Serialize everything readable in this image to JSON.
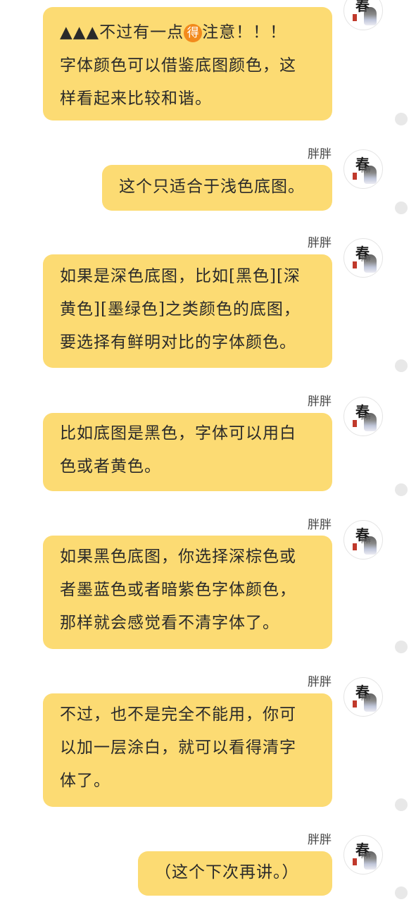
{
  "chat": {
    "messages": [
      {
        "sender": "",
        "lines": [
          "▲▲▲不过有一点{得}注意！！！",
          "字体颜色可以借鉴底图颜色，这",
          "样看起来比较和谐。"
        ],
        "line1_prefix": "▲▲▲不过有一点",
        "line1_badge": "得",
        "line1_suffix": "注意！！！"
      },
      {
        "sender": "胖胖",
        "lines": [
          "这个只适合于浅色底图。"
        ]
      },
      {
        "sender": "胖胖",
        "lines": [
          "如果是深色底图，比如[黑色][深",
          "黄色][墨绿色]之类颜色的底图，",
          "要选择有鲜明对比的字体颜色。"
        ]
      },
      {
        "sender": "胖胖",
        "lines": [
          "比如底图是黑色，字体可以用白",
          "色或者黄色。"
        ]
      },
      {
        "sender": "胖胖",
        "lines": [
          "如果黑色底图，你选择深棕色或",
          "者墨蓝色或者暗紫色字体颜色，",
          "那样就会感觉看不清字体了。"
        ]
      },
      {
        "sender": "胖胖",
        "lines": [
          "不过，也不是完全不能用，你可",
          "以加一层涂白，就可以看得清字",
          "体了。"
        ]
      },
      {
        "sender": "胖胖",
        "lines": [
          "（这个下次再讲。）"
        ]
      }
    ],
    "avatar": {
      "char": "春",
      "sub": "胖胖"
    },
    "colors": {
      "bubble": "#fcdb73",
      "badge": "#f28a1c",
      "status_dot": "#e8e8e8"
    }
  }
}
